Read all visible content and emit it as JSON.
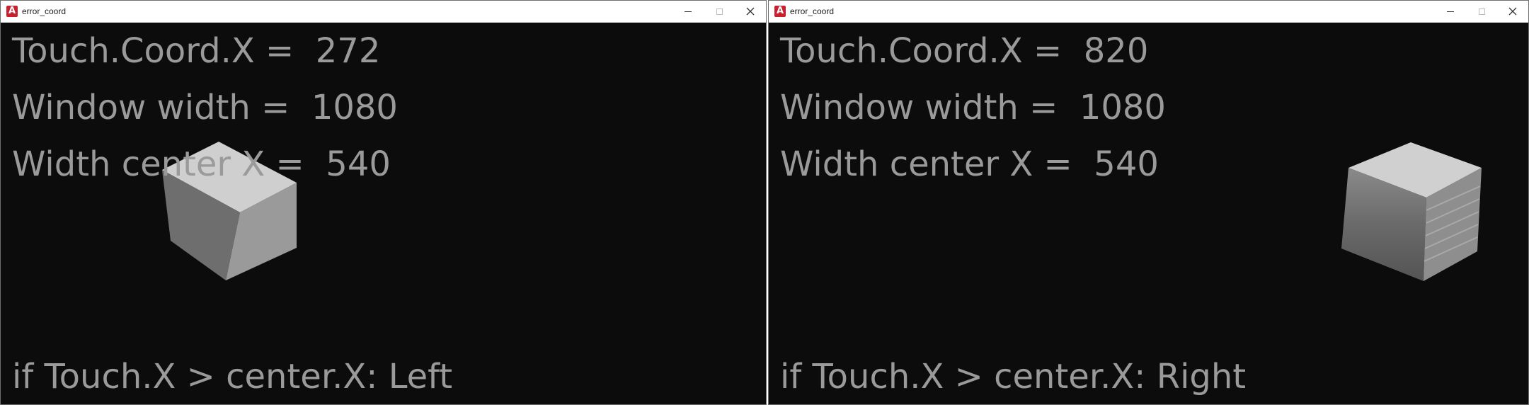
{
  "windows": [
    {
      "title": "error_coord",
      "app_icon": "A",
      "touch_coord_line": "Touch.Coord.X =  272",
      "window_width_line": "Window width =  1080",
      "width_center_line": "Width center X =  540",
      "condition_line": "if Touch.X > center.X: Left"
    },
    {
      "title": "error_coord",
      "app_icon": "A",
      "touch_coord_line": "Touch.Coord.X =  820",
      "window_width_line": "Window width =  1080",
      "width_center_line": "Width center X =  540",
      "condition_line": "if Touch.X > center.X: Right"
    }
  ],
  "colors": {
    "background": "#0c0c0c",
    "text": "#9a9a9a",
    "app_icon": "#c8202f",
    "cube_top": "#cfcfcf",
    "cube_left": "#6e6e6e",
    "cube_right": "#9a9a9a"
  },
  "icons": [
    "app-icon",
    "minimize-icon",
    "maximize-icon",
    "close-icon",
    "cube-3d"
  ]
}
